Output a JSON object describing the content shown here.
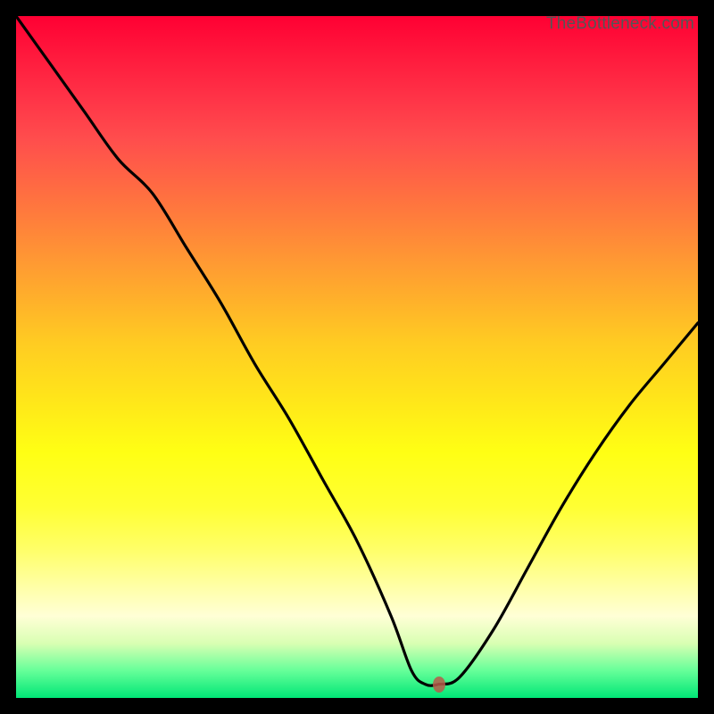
{
  "attribution": "TheBottleneck.com",
  "colors": {
    "background": "#000000",
    "curve_stroke": "#000000",
    "marker": "#b95a4a"
  },
  "chart_data": {
    "type": "line",
    "title": "",
    "xlabel": "",
    "ylabel": "",
    "xlim": [
      0,
      100
    ],
    "ylim": [
      0,
      100
    ],
    "grid": false,
    "legend": false,
    "series": [
      {
        "name": "bottleneck-curve",
        "x": [
          0,
          5,
          10,
          15,
          20,
          25,
          30,
          35,
          40,
          45,
          50,
          55,
          58,
          60,
          62,
          65,
          70,
          75,
          80,
          85,
          90,
          95,
          100
        ],
        "values": [
          100,
          93,
          86,
          79,
          74,
          66,
          58,
          49,
          41,
          32,
          23,
          12,
          4,
          2,
          2,
          3,
          10,
          19,
          28,
          36,
          43,
          49,
          55
        ]
      }
    ],
    "annotations": [
      {
        "name": "optimal-marker",
        "x": 62,
        "y": 2
      }
    ]
  }
}
